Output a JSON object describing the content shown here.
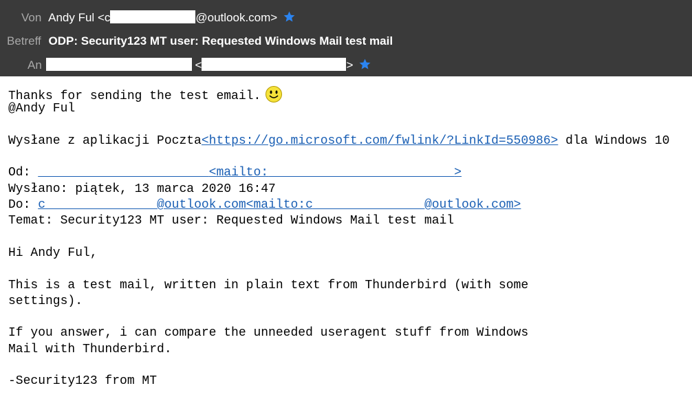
{
  "header": {
    "from_label": "Von",
    "from_name": "Andy Ful",
    "from_open": "<",
    "from_start": "c",
    "from_domain": "@outlook.com>",
    "subject_label": "Betreff",
    "subject": "ODP: Security123 MT user: Requested Windows Mail test mail",
    "to_label": "An",
    "to_lt": "<",
    "to_gt": ">",
    "star_color": "#2b84f0"
  },
  "body": {
    "line1": "Thanks for sending the test email.",
    "line2": "@Andy Ful",
    "sent_prefix": "Wysłane z aplikacji Poczta",
    "sent_link": "<https://go.microsoft.com/fwlink/?LinkId=550986>",
    "sent_suffix": " dla Windows 10",
    "od_label": "Od: ",
    "od_mailto": "<mailto:",
    "od_close": ">",
    "wyslano": "Wysłano: piątek, 13 marca 2020 16:47",
    "do_label": "Do: ",
    "do_link_start": "c",
    "do_domain": "@outlook.com<mailto:c",
    "do_domain_end": "@outlook.com>",
    "temat": "Temat: Security123 MT user: Requested Windows Mail test mail",
    "greeting": "Hi Andy Ful,",
    "p1_l1": "This is a test mail, written in plain text from Thunderbird (with some",
    "p1_l2": "settings).",
    "p2_l1": "If you answer, i can compare the unneeded useragent stuff from Windows",
    "p2_l2": "Mail with Thunderbird.",
    "signature": "-Security123 from MT"
  }
}
